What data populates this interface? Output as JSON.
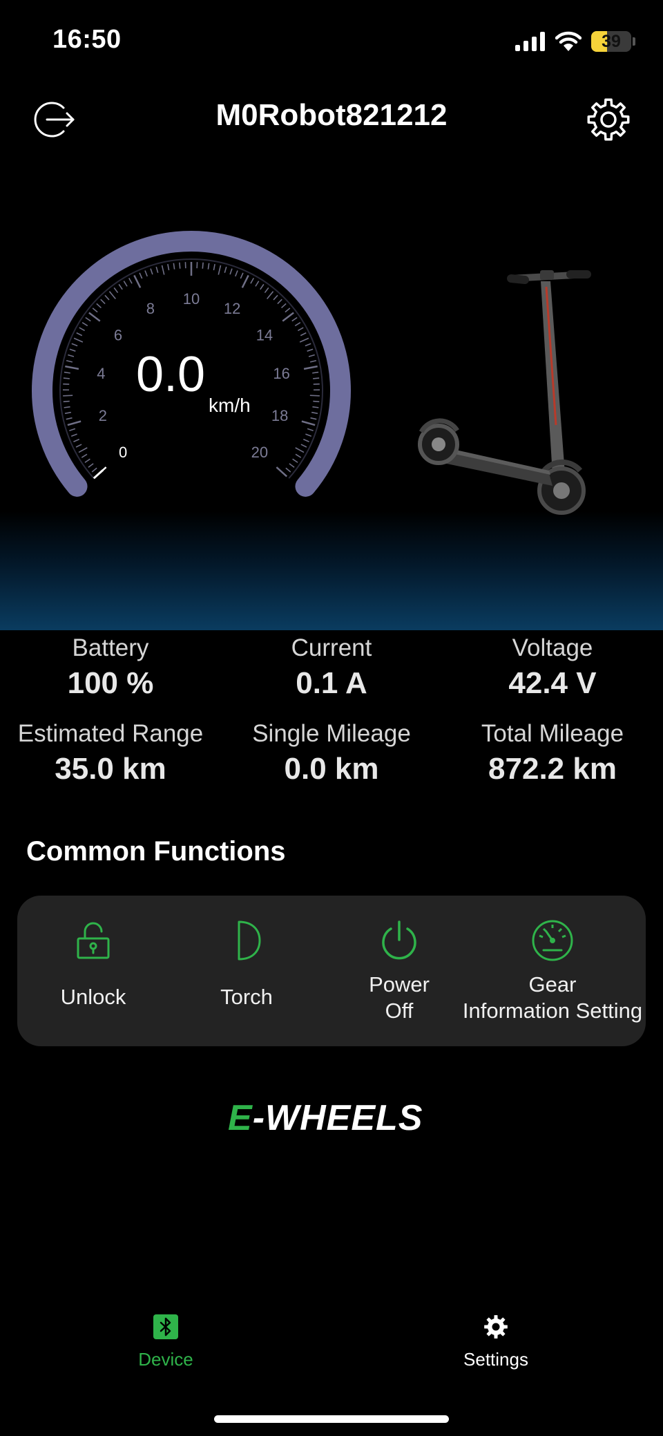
{
  "status_bar": {
    "time": "16:50",
    "battery": "39"
  },
  "header": {
    "title": "M0Robot821212"
  },
  "speedometer": {
    "speed": "0.0",
    "unit": "km/h",
    "ticks": [
      "0",
      "2",
      "4",
      "6",
      "8",
      "10",
      "12",
      "14",
      "16",
      "18",
      "20"
    ],
    "min": 0,
    "max": 20,
    "value": 0
  },
  "stats": {
    "battery": {
      "label": "Battery",
      "value": "100 %"
    },
    "current": {
      "label": "Current",
      "value": "0.1 A"
    },
    "voltage": {
      "label": "Voltage",
      "value": "42.4 V"
    },
    "range": {
      "label": "Estimated Range",
      "value": "35.0 km"
    },
    "single": {
      "label": "Single Mileage",
      "value": "0.0 km"
    },
    "total": {
      "label": "Total Mileage",
      "value": "872.2 km"
    }
  },
  "common": {
    "title": "Common Functions",
    "unlock": "Unlock",
    "torch": "Torch",
    "power_line1": "Power",
    "power_line2": "Off",
    "gear_line1": "Gear",
    "gear_line2": "Information Setting"
  },
  "logo": {
    "prefix": "E",
    "rest": "-WHEELS"
  },
  "nav": {
    "device": "Device",
    "settings": "Settings"
  },
  "colors": {
    "accent": "#2fb34a",
    "arc": "#6e6e9e",
    "background": "#000000",
    "card": "#232323"
  }
}
